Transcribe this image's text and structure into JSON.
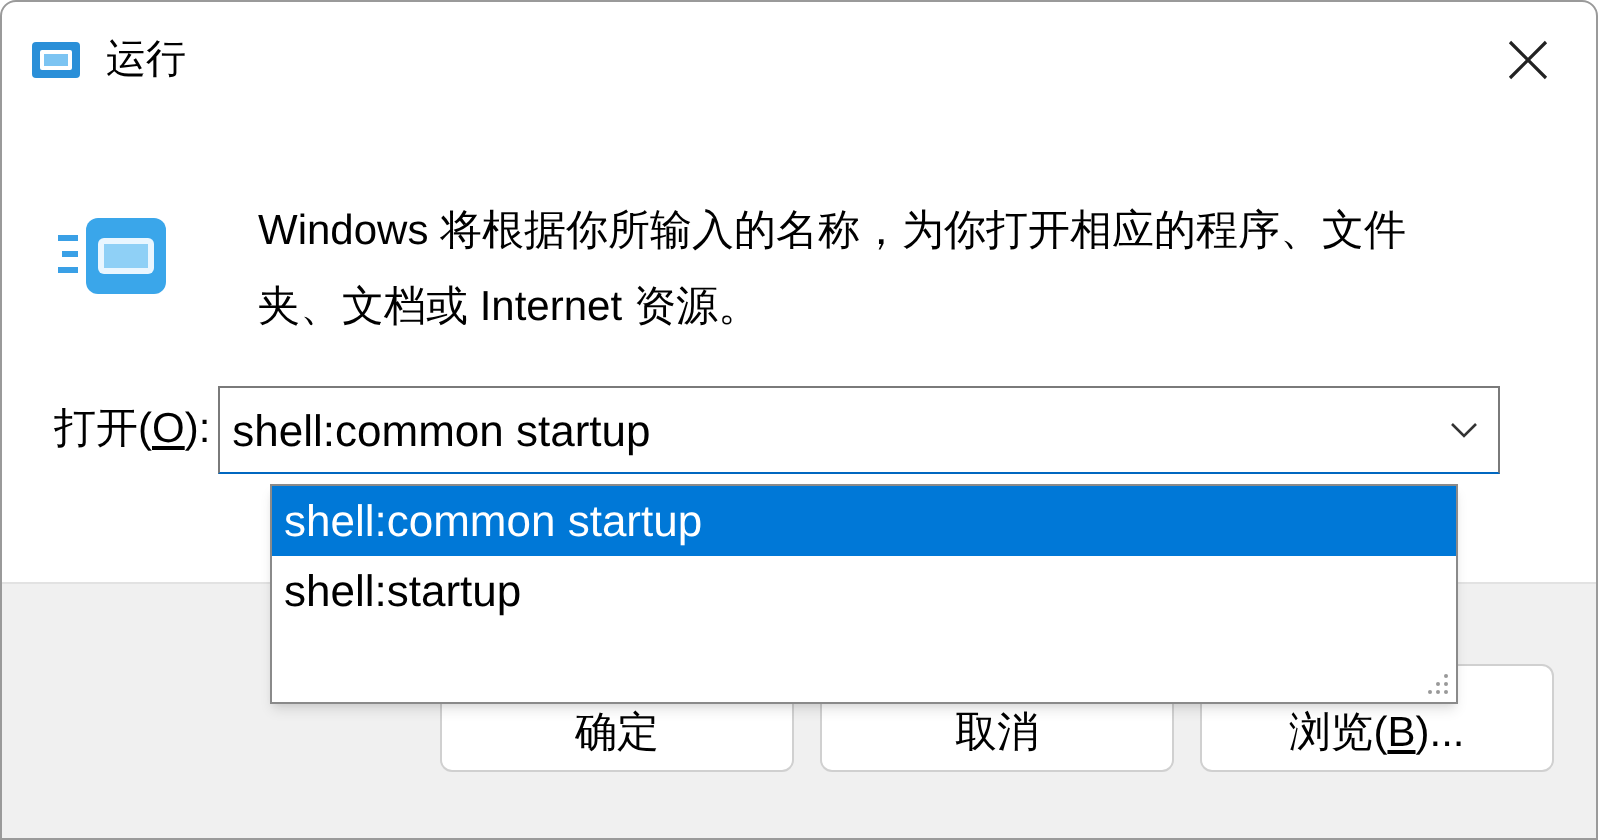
{
  "window": {
    "title": "运行"
  },
  "message": "Windows 将根据你所输入的名称，为你打开相应的程序、文件夹、文档或 Internet 资源。",
  "open_field": {
    "label_parts": [
      "打开(",
      "O",
      "):"
    ],
    "value": "shell:common startup",
    "expanded": true,
    "options": [
      {
        "label": "shell:common startup",
        "selected": true
      },
      {
        "label": "shell:startup",
        "selected": false
      }
    ]
  },
  "buttons": [
    {
      "label_parts": [
        "确定"
      ],
      "default": false
    },
    {
      "label_parts": [
        "取消"
      ],
      "default": false
    },
    {
      "label_parts": [
        "浏览(",
        "B",
        ")..."
      ],
      "default": false
    }
  ]
}
